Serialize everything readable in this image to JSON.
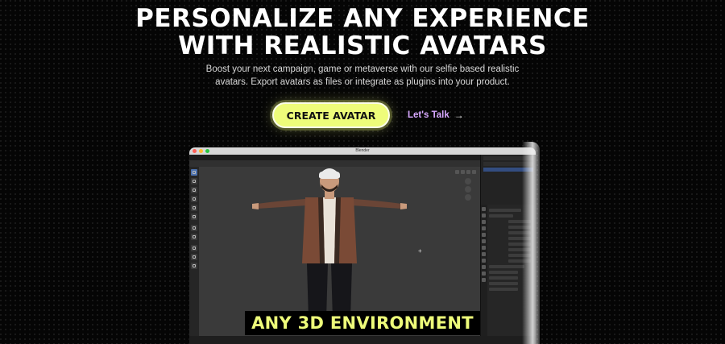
{
  "hero": {
    "headline_line1": "PERSONALIZE ANY EXPERIENCE",
    "headline_line2": "WITH REALISTIC AVATARS",
    "subtitle_line1": "Boost your next campaign, game or metaverse with our selfie based realistic",
    "subtitle_line2": "avatars. Export avatars as files or integrate as plugins into your product."
  },
  "cta": {
    "primary_label": "CREATE AVATAR",
    "secondary_label": "Let's Talk",
    "secondary_icon": "arrow-right-icon"
  },
  "app_window": {
    "title": "Blender",
    "viewport_caption": "ANY 3D ENVIRONMENT"
  },
  "colors": {
    "accent": "#eefc7a",
    "link": "#d7a8ff",
    "background": "#050505"
  }
}
